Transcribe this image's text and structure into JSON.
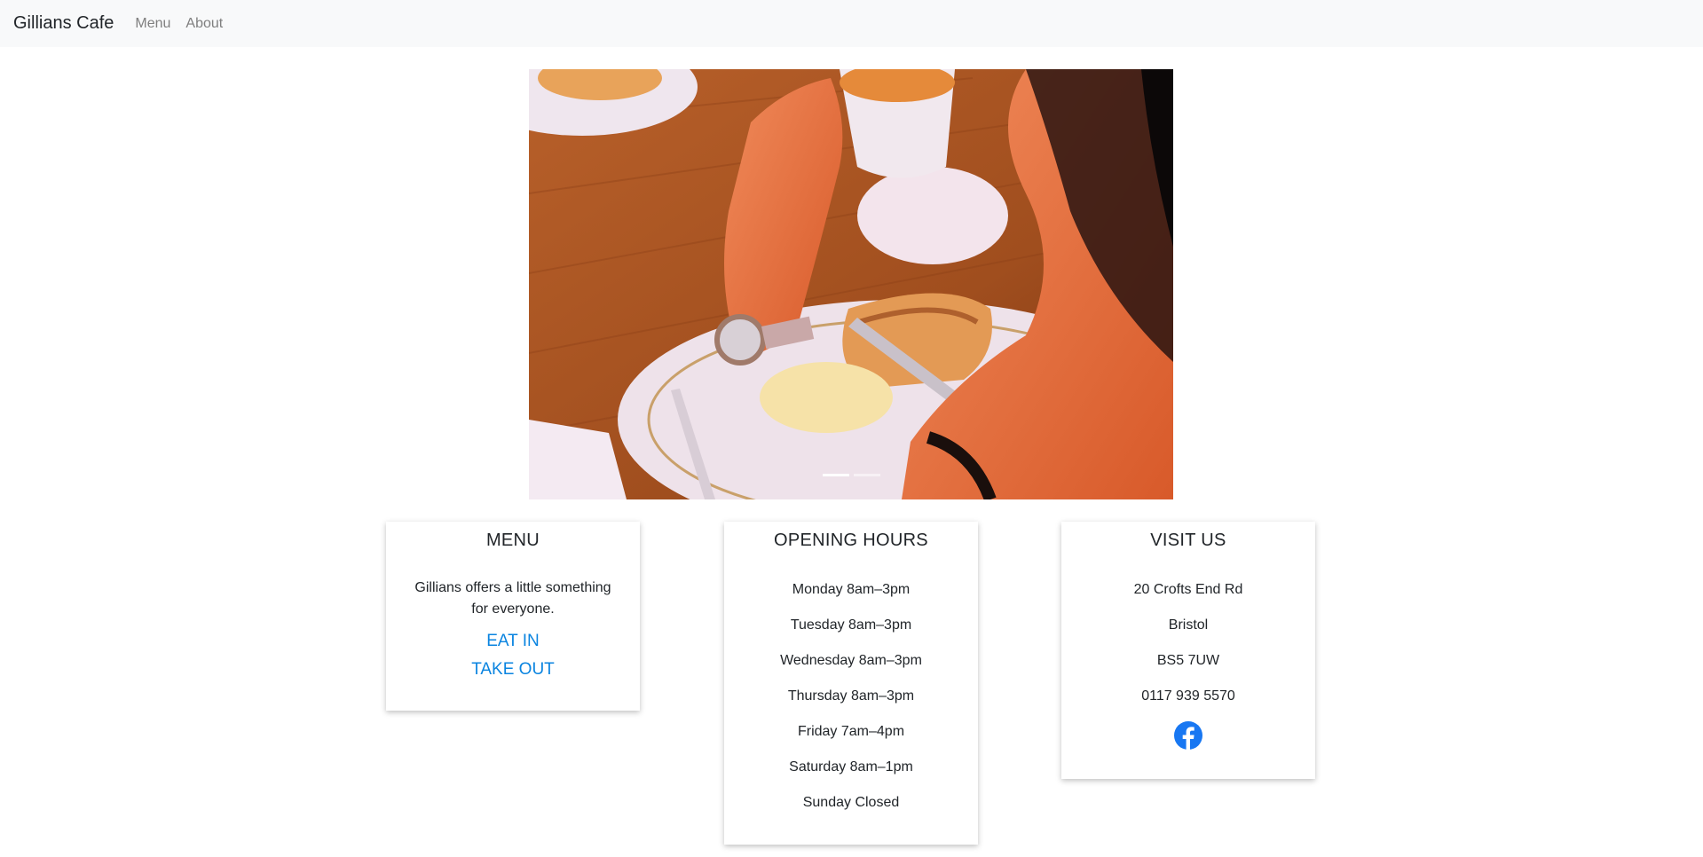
{
  "navbar": {
    "brand": "Gillians Cafe",
    "links": [
      "Menu",
      "About"
    ]
  },
  "carousel": {
    "slide_count": 2,
    "active_index": 0
  },
  "menu_card": {
    "title": "MENU",
    "text": "Gillians offers a little something for everyone.",
    "links": [
      "EAT IN",
      "TAKE OUT"
    ]
  },
  "hours_card": {
    "title": "OPENING HOURS",
    "hours": [
      "Monday 8am–3pm",
      "Tuesday 8am–3pm",
      "Wednesday 8am–3pm",
      "Thursday 8am–3pm",
      "Friday 7am–4pm",
      "Saturday 8am–1pm",
      "Sunday Closed"
    ]
  },
  "visit_card": {
    "title": "VISIT US",
    "lines": [
      "20 Crofts End Rd",
      "Bristol",
      "BS5 7UW",
      "0117 939 5570"
    ],
    "social_icon": "facebook-icon"
  },
  "colors": {
    "navbar_bg": "#f8f9fa",
    "link_blue": "#0a84e0",
    "facebook_blue": "#1877f2"
  }
}
